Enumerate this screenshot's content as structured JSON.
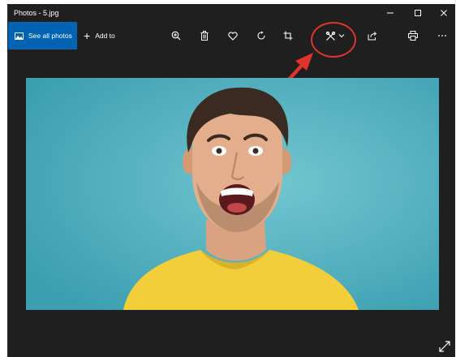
{
  "window": {
    "title": "Photos - 5.jpg",
    "controls": [
      "minimize-icon",
      "maximize-icon",
      "close-icon"
    ]
  },
  "toolbar": {
    "see_all_photos_label": "See all photos",
    "add_to_label": "Add to",
    "icons": [
      "zoom-in-icon",
      "delete-icon",
      "favorite-icon",
      "rotate-icon",
      "crop-icon",
      "edit-create-icon",
      "share-icon",
      "print-icon",
      "more-icon"
    ]
  },
  "annotation": {
    "highlight_color": "#e0332c"
  },
  "photo": {
    "background_color": "#4db2c1",
    "shirt_color": "#f2cf3a"
  },
  "colors": {
    "accent": "#0063b1",
    "chrome": "#1f1f1f"
  }
}
